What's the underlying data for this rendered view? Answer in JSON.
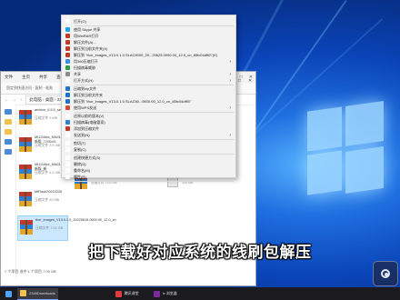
{
  "explorer": {
    "tabs": [
      "文件",
      "主页",
      "共享",
      "查看"
    ],
    "manage_tab": "管理",
    "tool_tab": "压缩文件工具",
    "ribbon_hint": "固定到快速访问 · 复制 · 粘贴",
    "address_path": "此电脑 › 桌面 › 2345Downloads",
    "status": "7 个项目   选中 1 个项目  7.05 GB",
    "files": [
      {
        "name": "archive_6.5.5_setup",
        "meta": "压缩文件 9 MB"
      },
      {
        "name": "MI12Ultra_MIUI14_3.0_新版_7700xSi",
        "meta": "压缩文件 3.5 GB"
      },
      {
        "name": "MI12Ultra_MIUI14_CODE_13.0_新版_新",
        "meta": "压缩文件 4.3 GB"
      },
      {
        "name": "MiFlash20210226",
        "meta": "压缩文件 50 MB"
      },
      {
        "name": "thor_images_V13.0.1.0_20220615.0000.00_12.0_cn",
        "meta": "压缩文件 7.02 GB",
        "selected": true
      }
    ],
    "bottom_files": [
      {
        "name": "M_20220706.0000.00_12.0_cn_...",
        "meta": "压缩文件 7.02 GB"
      },
      {
        "name": "Windows 服务工具",
        "meta": "330 MB"
      }
    ]
  },
  "context_menu": {
    "items": [
      {
        "label": "打开(O)",
        "icon_color": "#ffffff"
      },
      {
        "label": "使用 Skype 共享",
        "icon_color": "#1aa3e8"
      },
      {
        "label": "用WinRAR打开",
        "icon_color": "#c0392b"
      },
      {
        "label": "解压文件(A)...",
        "icon_color": "#c0392b"
      },
      {
        "label": "解压到当前文件夹(X)",
        "icon_color": "#c0392b"
      },
      {
        "label": "解压到 \"thor_images_V13.0.1.0.SLAC5000_20...20625.0000.00_12.0_cn_85fc04dff0\\\"(E)",
        "icon_color": "#c0392b"
      },
      {
        "label": "用360压缩打开",
        "icon_color": "#3a8ee6",
        "arrow": true
      },
      {
        "label": "扫描病毒威胁",
        "icon_color": "#2c9e4b"
      },
      {
        "label": "共享",
        "icon_color": "#8c8c8c",
        "arrow": true
      },
      {
        "label": "打开方式(H)",
        "icon_color": "#ffffff",
        "arrow": true
      },
      {
        "label": "压缩到zip文件",
        "icon_color": "#1f73c9"
      },
      {
        "label": "解压到当前文件夹",
        "icon_color": "#1f73c9"
      },
      {
        "label": "解压到 \"thor_images_V13.0.1.0.SLAC50...0000.00_12.0_cn_85fc04dff0\\\"",
        "icon_color": "#1f73c9"
      },
      {
        "label": "使用WPS发送",
        "icon_color": "#d14836",
        "arrow": true
      },
      {
        "label": "还原以前的版本(V)",
        "icon_color": "#ffffff"
      },
      {
        "label": "扫描病毒(电脑管家)",
        "icon_color": "#2c7fd1"
      },
      {
        "label": "添加到压缩文件",
        "icon_color": "#c0392b"
      },
      {
        "label": "发送到(N)",
        "icon_color": "#ffffff",
        "arrow": true
      },
      {
        "label": "剪切(T)",
        "icon_color": "#ffffff"
      },
      {
        "label": "复制(C)",
        "icon_color": "#ffffff"
      },
      {
        "label": "创建快捷方式(S)",
        "icon_color": "#ffffff"
      },
      {
        "label": "删除(D)",
        "icon_color": "#ffffff"
      },
      {
        "label": "重命名(M)",
        "icon_color": "#ffffff"
      },
      {
        "label": "属性(R)",
        "icon_color": "#ffffff"
      }
    ]
  },
  "caption": "把下载好对应系统的线刷包解压",
  "taskbar": {
    "items": [
      {
        "label": "2345Downloads",
        "color": "#f2c14e",
        "active": true
      },
      {
        "label": "腾讯课堂",
        "color": "#e23b3b",
        "active": false
      },
      {
        "label": "lx 浏览器",
        "color": "#7a2b9b",
        "active": false
      }
    ]
  },
  "colors": {
    "accent": "#1f6fe0",
    "selection": "#cce8ff"
  }
}
